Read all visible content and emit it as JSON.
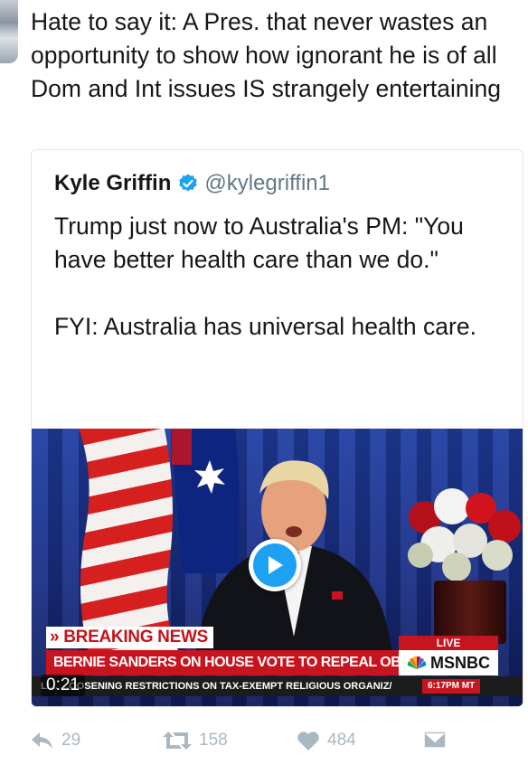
{
  "tweet": {
    "text": "Hate to say it: A Pres. that never wastes an opportunity to show how ignorant he is of all Dom and Int issues IS strangely entertaining"
  },
  "quoted_tweet": {
    "author_name": "Kyle Griffin",
    "verified_icon": "verified-badge-icon",
    "handle": "@kylegriffin1",
    "text_line1": "Trump just now to Australia's PM: \"You have better health care than we do.\"",
    "text_line2": "FYI: Australia has universal health care.",
    "video": {
      "play_icon": "play-icon",
      "duration": "0:21",
      "chyron_label": "BREAKING NEWS",
      "chyron_headline": "BERNIE SANDERS ON HOUSE VOTE TO REPEAL OBAMACARE",
      "live_label": "LIVE",
      "network": "MSNBC",
      "ticker": "LI... ...OOSENING RESTRICTIONS ON TAX-EXEMPT RELIGIOUS ORGANIZ/",
      "ticker_time": "6:17PM MT"
    }
  },
  "actions": {
    "reply_count": "29",
    "retweet_count": "158",
    "like_count": "484",
    "icons": [
      "reply-icon",
      "retweet-icon",
      "heart-icon",
      "direct-message-icon"
    ]
  },
  "colors": {
    "text": "#14171a",
    "secondary": "#657786",
    "action_gray": "#aab8c2",
    "accent_blue": "#1da1f2",
    "news_red": "#c8141e"
  }
}
